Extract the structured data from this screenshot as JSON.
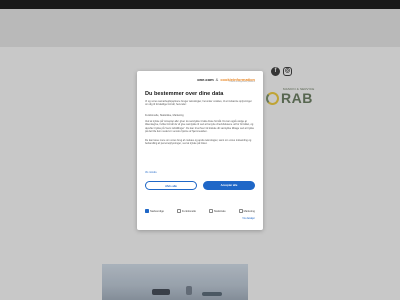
{
  "background": {
    "social": {
      "facebook_icon": "f",
      "instagram_icon": "◎"
    },
    "logo": {
      "small_text": "MASKIN & SERVICE",
      "brand_text": "RAB"
    }
  },
  "dialog": {
    "logos": {
      "one_com": "one.com",
      "amp": "&",
      "cookie_information": "cookieinformation",
      "sub": "Cookie management platform"
    },
    "title": "Du bestemmer over dine data",
    "paragraphs": [
      "Vi og vores samarbejdspartnere bruger teknologier, herunder cookies, til at indsamle oplysninger om dig til forskellige formål, herunder:",
      "Funktionelle, Statistiske, Marketing",
      "Ved at trykke på 'Accepter alle' giver du samtykke til alle disse formål. Du kan også vælge at tilkendegive, hvilke formål du vil give samtykke til ved at benytte checkboksene ud for formålet, og derefter trykke på 'Gem indstillinger'. Du kan til enhver tid trække dit samtykke tilbage ved at trykke på det lille ikon nederst i venstre hjørne af hjemmesiden.",
      "Du kan læse mere om vores brug af cookies og andre teknologier, samt om vores indsamling og behandling af personoplysninger, ved at trykke på linket."
    ],
    "more_link": "Vis mindre",
    "reject_label": "Afvis alle",
    "accept_label": "Accepter alle",
    "categories": [
      {
        "label": "Nødvendige",
        "checked": true
      },
      {
        "label": "Funktionelle",
        "checked": false
      },
      {
        "label": "Statistiske",
        "checked": false
      },
      {
        "label": "Marketing",
        "checked": false
      }
    ],
    "details_link": "Vis detaljer"
  },
  "colors": {
    "accent": "#1f67c7",
    "topbar": "#1c1c1c",
    "cookie_orange": "#e8892a"
  }
}
